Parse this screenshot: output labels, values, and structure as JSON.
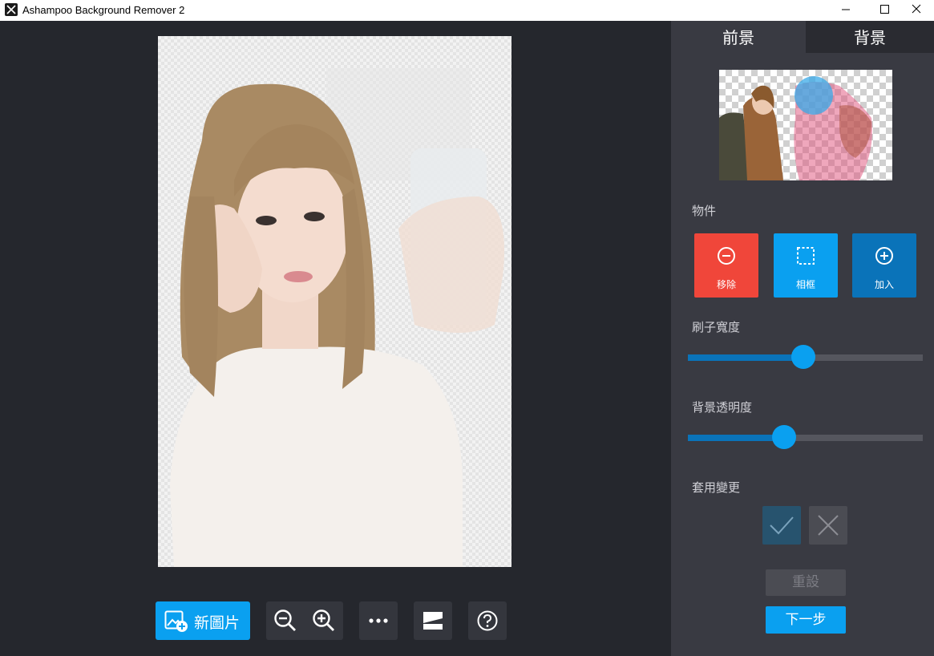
{
  "window": {
    "title": "Ashampoo Background Remover 2",
    "icons": [
      "app-icon",
      "minimize-icon",
      "maximize-icon",
      "close-icon"
    ]
  },
  "toolbar": {
    "new_image_label": "新圖片",
    "icons": [
      "new-image-icon",
      "zoom-out-icon",
      "zoom-in-icon",
      "more-icon",
      "compare-icon",
      "help-icon"
    ]
  },
  "panel": {
    "tabs": [
      {
        "label": "前景",
        "active": true
      },
      {
        "label": "背景",
        "active": false
      }
    ],
    "objects": {
      "label": "物件",
      "buttons": [
        {
          "label": "移除",
          "icon": "minus-circle-icon",
          "color": "#f0463a"
        },
        {
          "label": "相框",
          "icon": "selection-frame-icon",
          "color": "#0aa0f0"
        },
        {
          "label": "加入",
          "icon": "plus-circle-icon",
          "color": "#0a73b9"
        }
      ]
    },
    "brush_width": {
      "label": "刷子寬度",
      "value": 0.49
    },
    "bg_opacity": {
      "label": "背景透明度",
      "value": 0.41
    },
    "apply": {
      "label": "套用變更",
      "icons": [
        "check-icon",
        "cross-icon"
      ]
    },
    "reset_label": "重設",
    "next_label": "下一步"
  },
  "colors": {
    "accent": "#0aa0f0",
    "remove": "#f0463a",
    "add": "#0a73b9",
    "panel_bg": "#393a42",
    "canvas_bg": "#25272d"
  }
}
